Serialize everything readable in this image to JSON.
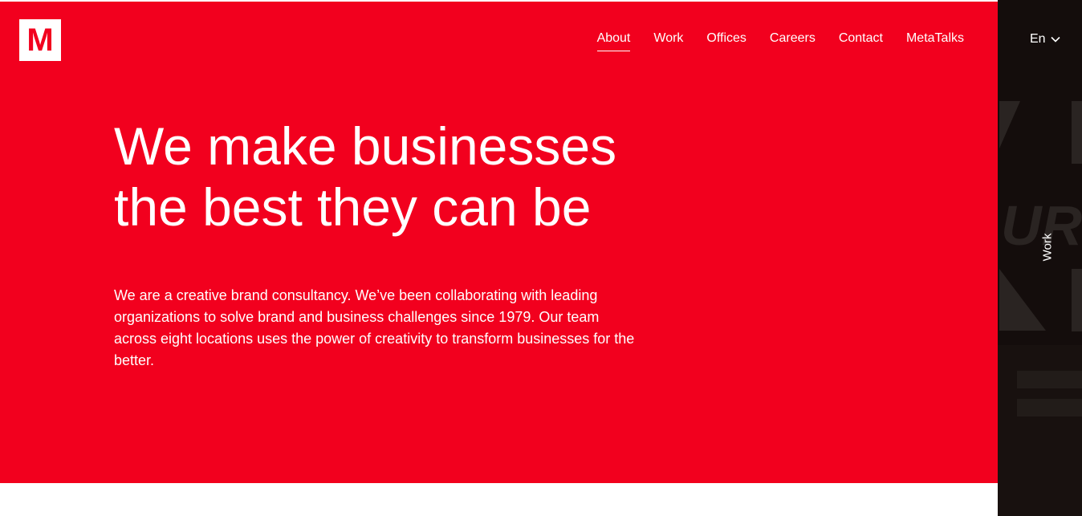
{
  "brand": {
    "logo_letter": "M"
  },
  "nav": {
    "items": [
      {
        "label": "About"
      },
      {
        "label": "Work"
      },
      {
        "label": "Offices"
      },
      {
        "label": "Careers"
      },
      {
        "label": "Contact"
      },
      {
        "label": "MetaTalks"
      }
    ],
    "active": "About"
  },
  "language": {
    "label": "En",
    "icon": "chevron-down-icon"
  },
  "hero": {
    "headline_line1": "We make businesses",
    "headline_line2": "the best they can be",
    "intro": "We are a creative brand consultancy. We’ve been collaborating with leading organizations to solve brand and business challenges since 1979. Our team across eight locations uses the power of creativity to transform businesses for the better."
  },
  "side_panel": {
    "label": "Work"
  },
  "colors": {
    "brand_red": "#f2001e",
    "side_dark": "#140d0c",
    "text": "#ffffff"
  }
}
